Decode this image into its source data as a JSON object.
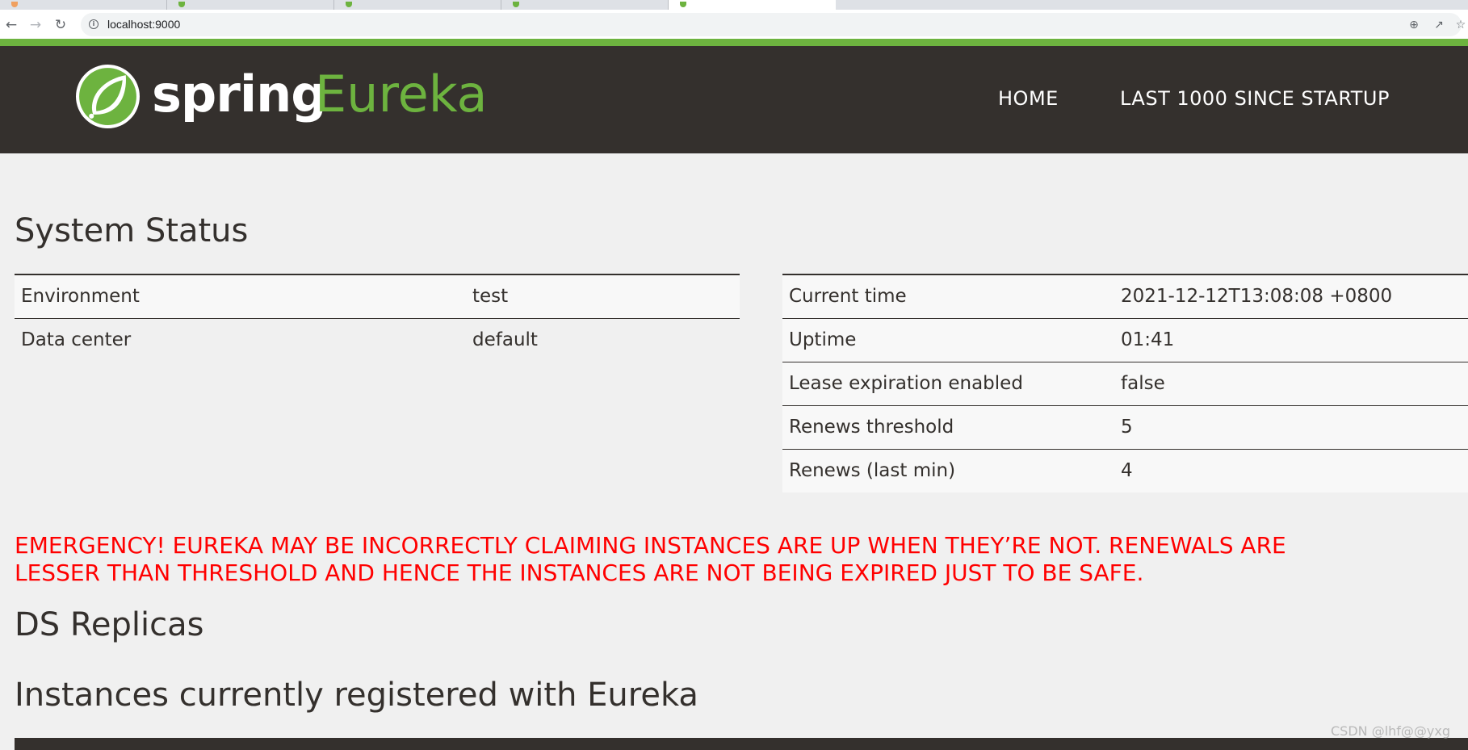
{
  "browser": {
    "url": "localhost:9000"
  },
  "brand": {
    "word1": "spring",
    "word2": "Eureka"
  },
  "nav": {
    "home": "HOME",
    "last1000": "LAST 1000 SINCE STARTUP"
  },
  "system_status": {
    "title": "System Status",
    "left": [
      {
        "label": "Environment",
        "value": "test"
      },
      {
        "label": "Data center",
        "value": "default"
      }
    ],
    "right": [
      {
        "label": "Current time",
        "value": "2021-12-12T13:08:08 +0800"
      },
      {
        "label": "Uptime",
        "value": "01:41"
      },
      {
        "label": "Lease expiration enabled",
        "value": "false"
      },
      {
        "label": "Renews threshold",
        "value": "5"
      },
      {
        "label": "Renews (last min)",
        "value": "4"
      }
    ]
  },
  "emergency": {
    "line1": "EMERGENCY! EUREKA MAY BE INCORRECTLY CLAIMING INSTANCES ARE UP WHEN THEY’RE NOT. RENEWALS ARE",
    "line2": "LESSER THAN THRESHOLD AND HENCE THE INSTANCES ARE NOT BEING EXPIRED JUST TO BE SAFE."
  },
  "ds_replicas": {
    "title": "DS Replicas"
  },
  "instances": {
    "title": "Instances currently registered with Eureka"
  },
  "watermark": "CSDN @lhf@@yxg",
  "colors": {
    "brand_green": "#6db33f",
    "navbar_bg": "#34302d",
    "emergency_red": "#ff0000",
    "page_bg": "#f0f0f0"
  },
  "icons": {
    "back": "back-arrow-icon",
    "forward": "forward-arrow-icon",
    "reload": "reload-icon",
    "site_info": "info-icon",
    "zoom": "zoom-icon",
    "share": "share-icon",
    "bookmark": "star-icon",
    "logo": "spring-leaf-icon"
  }
}
